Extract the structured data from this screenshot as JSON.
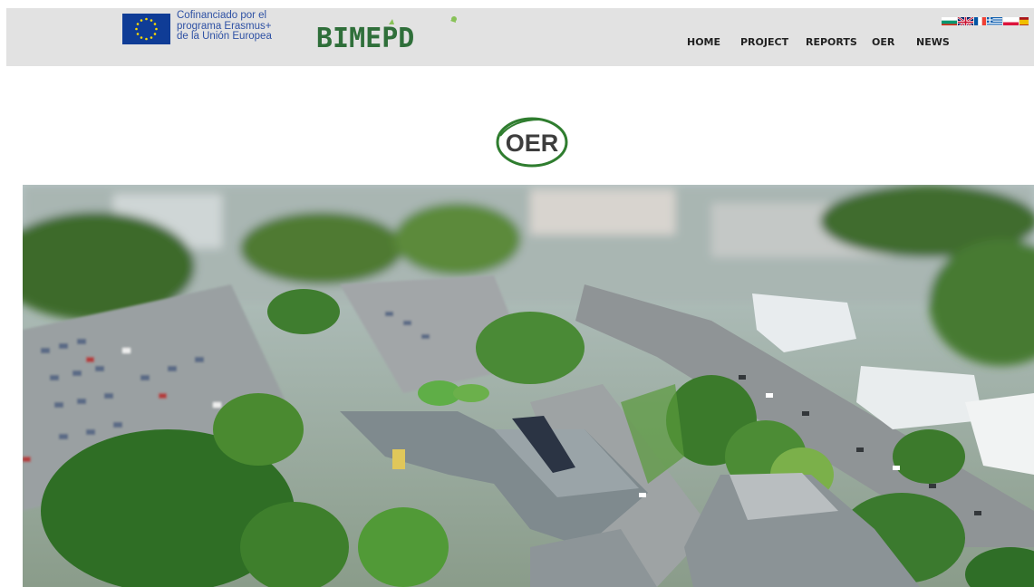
{
  "header": {
    "eu_funding": {
      "line1": "Cofinanciado por el",
      "line2": "programa Erasmus+",
      "line3": "de la Unión Europea"
    },
    "logo_text": "BIMEPD",
    "nav": [
      {
        "label": "HOME"
      },
      {
        "label": "PROJECT"
      },
      {
        "label": "REPORTS"
      },
      {
        "label": "OER"
      },
      {
        "label": "NEWS"
      }
    ],
    "languages": [
      "bulgarian-flag-icon",
      "uk-flag-icon",
      "france-flag-icon",
      "greece-flag-icon",
      "poland-flag-icon",
      "spain-flag-icon"
    ]
  },
  "page": {
    "badge": "OER"
  },
  "colors": {
    "header_bg": "#e2e2e2",
    "eu_blue": "#0f3c96",
    "eu_text": "#2e51a4",
    "logo_green": "#3b7b3f",
    "badge_green": "#2f7d2f",
    "badge_text": "#3d3d3d"
  }
}
